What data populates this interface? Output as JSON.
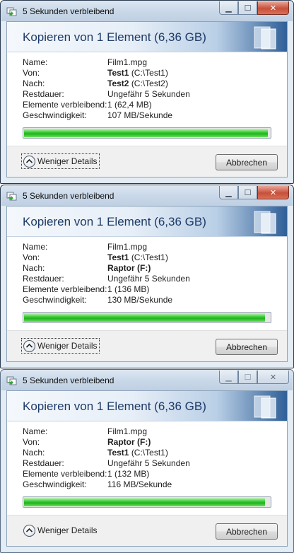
{
  "dialogs": [
    {
      "window_title": "5 Sekunden verbleibend",
      "heading": "Kopieren von 1 Element (6,36 GB)",
      "labels": {
        "name": "Name:",
        "from": "Von:",
        "to": "Nach:",
        "remaining_time": "Restdauer:",
        "items_remaining": "Elemente verbleibend:",
        "speed": "Geschwindigkeit:"
      },
      "name_value": "Film1.mpg",
      "from_bold": "Test1",
      "from_path": "(C:\\Test1)",
      "to_bold": "Test2",
      "to_path": "(C:\\Test2)",
      "remaining_time_value": "Ungefähr 5 Sekunden",
      "items_remaining_value": "1 (62,4 MB)",
      "speed_value": "107 MB/Sekunde",
      "progress_percent": 99,
      "fewer_details_label": "Weniger Details",
      "cancel_label": "Abbrechen"
    },
    {
      "window_title": "5 Sekunden verbleibend",
      "heading": "Kopieren von 1 Element (6,36 GB)",
      "labels": {
        "name": "Name:",
        "from": "Von:",
        "to": "Nach:",
        "remaining_time": "Restdauer:",
        "items_remaining": "Elemente verbleibend:",
        "speed": "Geschwindigkeit:"
      },
      "name_value": "Film1.mpg",
      "from_bold": "Test1",
      "from_path": "(C:\\Test1)",
      "to_bold": "Raptor (F:)",
      "to_path": "",
      "remaining_time_value": "Ungefähr 5 Sekunden",
      "items_remaining_value": "1 (136 MB)",
      "speed_value": "130 MB/Sekunde",
      "progress_percent": 98,
      "fewer_details_label": "Weniger Details",
      "cancel_label": "Abbrechen"
    },
    {
      "window_title": "5 Sekunden verbleibend",
      "heading": "Kopieren von 1 Element (6,36 GB)",
      "labels": {
        "name": "Name:",
        "from": "Von:",
        "to": "Nach:",
        "remaining_time": "Restdauer:",
        "items_remaining": "Elemente verbleibend:",
        "speed": "Geschwindigkeit:"
      },
      "name_value": "Film1.mpg",
      "from_bold": "Raptor (F:)",
      "from_path": "",
      "to_bold": "Test1",
      "to_path": "(C:\\Test1)",
      "remaining_time_value": "Ungefähr 5 Sekunden",
      "items_remaining_value": "1 (132 MB)",
      "speed_value": "116 MB/Sekunde",
      "progress_percent": 98,
      "fewer_details_label": "Weniger Details",
      "cancel_label": "Abbrechen"
    }
  ],
  "icons": {
    "title_icon": "copy-files-icon",
    "banner_icon": "document-transfer-icon",
    "chevron": "chevron-up-icon",
    "minimize": "minimize-icon",
    "maximize": "maximize-icon",
    "close": "close-icon"
  },
  "colors": {
    "progress_green": "#1fb31c",
    "heading_blue": "#1e3a66",
    "close_red": "#c7503a"
  }
}
